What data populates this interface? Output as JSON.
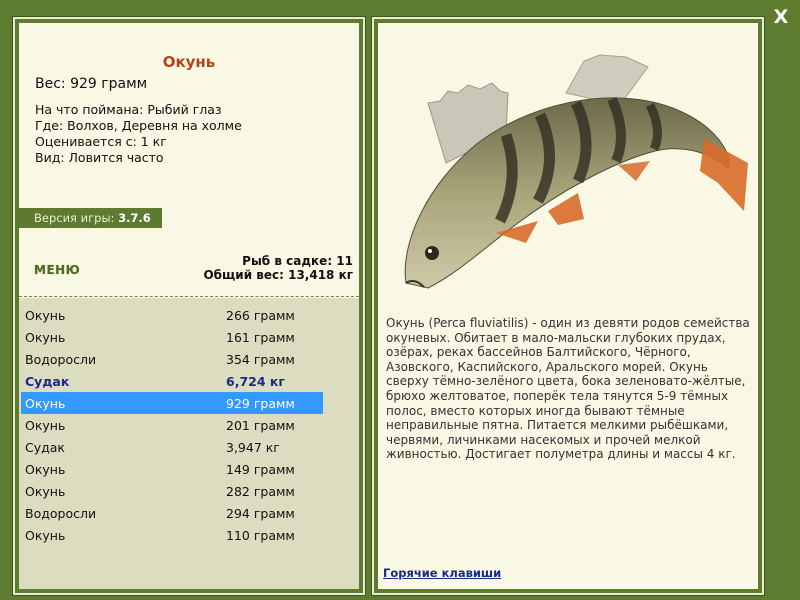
{
  "window": {
    "close_label": "X"
  },
  "fish": {
    "name": "Окунь",
    "weight": "Вес: 929 грамм",
    "caught_with": "На что поймана: Рыбий глаз",
    "location": "Где: Волхов, Деревня на холме",
    "price": "Оценивается с: 1 кг",
    "kind": "Вид: Ловится часто",
    "description": "Окунь (Perca fluviatilis) - один из девяти родов семейства окуневых. Обитает в мало-мальски глубоких прудах, озёрах, реках бассейнов Балтийского, Чёрного, Азовского, Каспийского, Аральского морей. Окунь сверху тёмно-зелёного цвета, бока зеленовато-жёлтые, брюхо желтоватое, поперёк тела тянутся 5-9 тёмных полос, вместо которых иногда бывают тёмные неправильные пятна. Питается мелкими рыбёшками, червями, личинками насекомых и прочей мелкой живностью. Достигает полуметра длины и массы 4 кг."
  },
  "version": {
    "label": "Версия игры:",
    "value": "3.7.6"
  },
  "menu": {
    "label": "МЕНЮ"
  },
  "keepnet": {
    "count": "Рыб в садке: 11",
    "total_weight": "Общий вес: 13,418 кг"
  },
  "catch_list": [
    {
      "name": "Окунь",
      "weight": "266 грамм"
    },
    {
      "name": "Окунь",
      "weight": "161 грамм"
    },
    {
      "name": "Водоросли",
      "weight": "354 грамм"
    },
    {
      "name": "Судак",
      "weight": "6,724 кг"
    },
    {
      "name": "Окунь",
      "weight": "929 грамм"
    },
    {
      "name": "Окунь",
      "weight": "201 грамм"
    },
    {
      "name": "Судак",
      "weight": "3,947 кг"
    },
    {
      "name": "Окунь",
      "weight": "149 грамм"
    },
    {
      "name": "Окунь",
      "weight": "282 грамм"
    },
    {
      "name": "Водоросли",
      "weight": "294 грамм"
    },
    {
      "name": "Окунь",
      "weight": "110 грамм"
    }
  ],
  "catch_state": {
    "highlighted_index": 3,
    "selected_index": 4
  },
  "links": {
    "hotkeys": "Горячие клавиши"
  },
  "colors": {
    "frame": "#5e7c30",
    "panel": "#f8f8e4",
    "title": "#b3441a",
    "selection": "#3399ff",
    "highlight_text": "#1a2a86"
  }
}
